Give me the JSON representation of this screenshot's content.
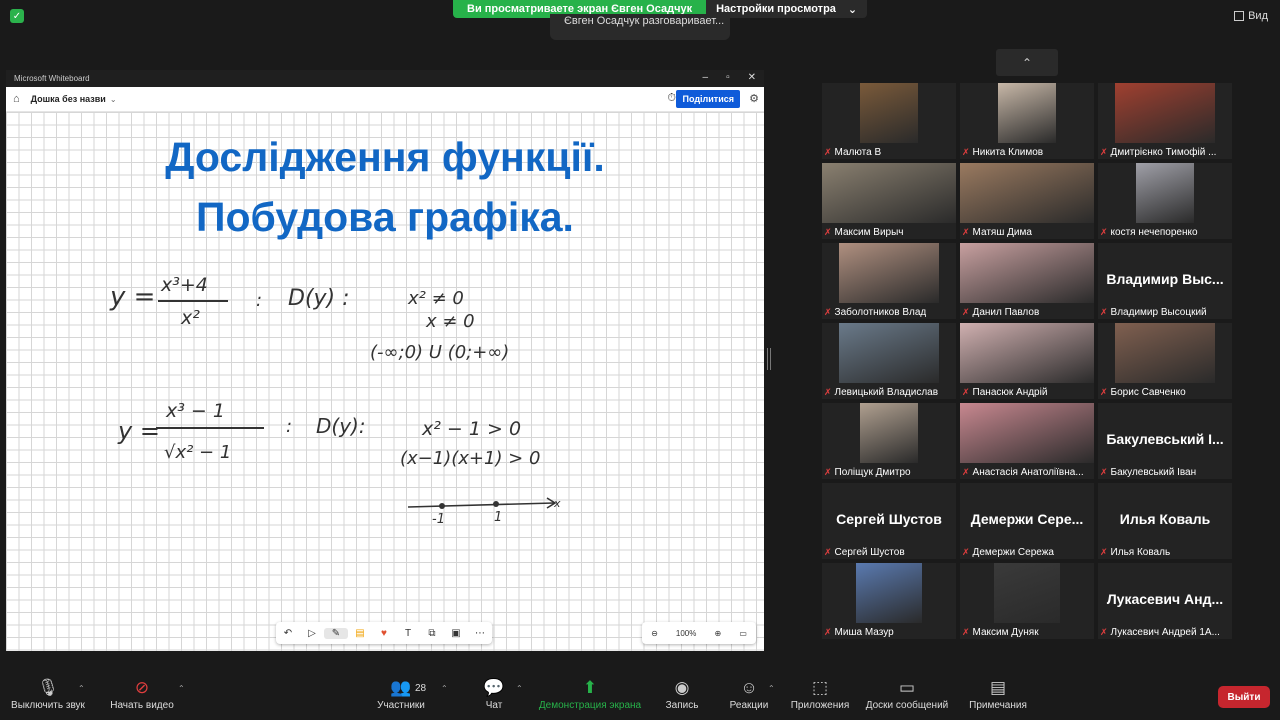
{
  "top": {
    "share_banner": "Ви просматриваете экран Євген Осадчук",
    "view_options": "Настройки просмотра",
    "talking": "Євген Осадчук разговаривает...",
    "view_label": "Вид"
  },
  "whiteboard": {
    "app_title": "Microsoft Whiteboard",
    "board_name": "Дошка без назви",
    "share_label": "Поділитися",
    "title_line1": "Дослідження функції.",
    "title_line2": "Побудова графіка.",
    "zoom": "100%",
    "handwriting": {
      "eq1_y": "y =",
      "eq1_num": "x³+4",
      "eq1_den": "x²",
      "eq1_colon": ":",
      "eq1_domain": "D(y) :",
      "eq1_cond1": "x² ≠ 0",
      "eq1_cond2": "x ≠ 0",
      "eq1_result": "(-∞;0) U (0;+∞)",
      "eq2_y": "y =",
      "eq2_num": "x³ − 1",
      "eq2_den": "√x² − 1",
      "eq2_colon": ":",
      "eq2_domain": "D(y):",
      "eq2_cond1": "x² − 1 > 0",
      "eq2_cond2": "(x−1)(x+1) > 0",
      "axis_x": "x",
      "tick_neg1": "-1",
      "tick_1": "1"
    }
  },
  "participants": [
    {
      "name": "Малюта В",
      "video": true,
      "color": "#7a5a3a"
    },
    {
      "name": "Никита Климов",
      "video": true,
      "color": "#c8b8a8"
    },
    {
      "name": "Дмитрієнко Тимофій ...",
      "video": true,
      "color": "#a04030"
    },
    {
      "name": "Максим Вирыч",
      "video": true,
      "color": "#8a8070"
    },
    {
      "name": "Матяш Дима",
      "video": true,
      "color": "#9a7a60"
    },
    {
      "name": "костя нечепоренко",
      "video": true,
      "color": "#a0a0a8"
    },
    {
      "name": "Заболотников Влад",
      "video": true,
      "color": "#b09080"
    },
    {
      "name": "Данил Павлов",
      "video": true,
      "color": "#c8a0a0"
    },
    {
      "name": "Владимир Высоцкий",
      "video": false,
      "big": "Владимир  Выс..."
    },
    {
      "name": "Левицький Владислав",
      "video": true,
      "color": "#6a7a8a"
    },
    {
      "name": "Панасюк Андрій",
      "video": true,
      "color": "#d0b0b0"
    },
    {
      "name": "Борис Савченко",
      "video": true,
      "color": "#806050"
    },
    {
      "name": "Поліщук Дмитро",
      "video": true,
      "color": "#b0a090"
    },
    {
      "name": "Анастасія Анатоліївна...",
      "video": true,
      "color": "#c88890"
    },
    {
      "name": "Бакулевський Іван",
      "video": false,
      "big": "Бакулевський І..."
    },
    {
      "name": "Сергей Шустов",
      "video": false,
      "big": "Сергей Шустов"
    },
    {
      "name": "Демержи Сережа",
      "video": false,
      "big": "Демержи  Сере..."
    },
    {
      "name": "Илья Коваль",
      "video": false,
      "big": "Илья Коваль"
    },
    {
      "name": "Миша Мазур",
      "video": true,
      "color": "#5a7ab0"
    },
    {
      "name": "Максим Дуняк",
      "video": true,
      "color": "#3a3a3a"
    },
    {
      "name": "Лукасевич Андрей 1А...",
      "video": false,
      "big": "Лукасевич  Анд..."
    }
  ],
  "toolbar": {
    "mute": "Выключить звук",
    "video": "Начать видео",
    "participants": "Участники",
    "participants_count": "28",
    "chat": "Чат",
    "share": "Демонстрация экрана",
    "record": "Запись",
    "reactions": "Реакции",
    "apps": "Приложения",
    "boards": "Доски сообщений",
    "notes": "Примечания",
    "leave": "Выйти"
  },
  "colors": {
    "accent_green": "#27b24a",
    "share_blue": "#0f5bd9",
    "title_blue": "#1267c4",
    "leave_red": "#c6262e"
  }
}
